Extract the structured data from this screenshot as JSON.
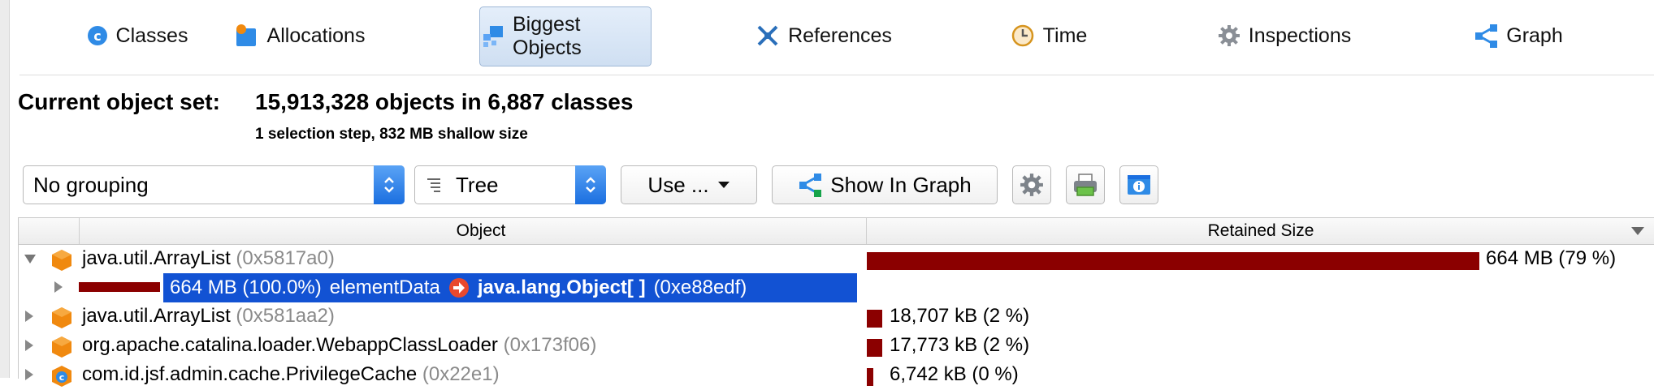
{
  "tabs": [
    {
      "label": "Classes",
      "icon": "classes-icon"
    },
    {
      "label": "Allocations",
      "icon": "allocations-icon"
    },
    {
      "label": "Biggest Objects",
      "icon": "biggest-objects-icon",
      "active": true
    },
    {
      "label": "References",
      "icon": "references-icon"
    },
    {
      "label": "Time",
      "icon": "time-icon"
    },
    {
      "label": "Inspections",
      "icon": "inspections-icon"
    },
    {
      "label": "Graph",
      "icon": "graph-icon"
    }
  ],
  "header": {
    "label": "Current object set:",
    "value": "15,913,328 objects in 6,887 classes",
    "sub": "1 selection step, 832 MB shallow size"
  },
  "toolbar": {
    "grouping": "No grouping",
    "view": "Tree",
    "use_label": "Use ...",
    "show_in_graph": "Show In Graph",
    "icon_buttons": [
      "settings-icon",
      "export-icon",
      "info-icon"
    ]
  },
  "table": {
    "columns": {
      "object": "Object",
      "retained": "Retained Size"
    },
    "rows": [
      {
        "expanded": true,
        "cls": "java.util.ArrayList",
        "addr": "(0x5817a0)",
        "size": "664 MB (79 %)",
        "fraction": 0.79
      },
      {
        "selected": true,
        "size": "664 MB (100.0%)",
        "field": "elementData",
        "target": "java.lang.Object[ ]",
        "target_addr": "(0xe88edf)",
        "fraction": 1.0
      },
      {
        "cls": "java.util.ArrayList",
        "addr": "(0x581aa2)",
        "size": "18,707 kB (2 %)",
        "fraction": 0.02
      },
      {
        "cls": "org.apache.catalina.loader.WebappClassLoader",
        "addr": "(0x173f06)",
        "size": "17,773 kB (2 %)",
        "fraction": 0.02
      },
      {
        "cls": "com.id.jsf.admin.cache.PrivilegeCache",
        "addr": "(0x22e1)",
        "size": "6,742 kB (0 %)",
        "fraction": 0.008
      }
    ]
  },
  "colors": {
    "bar": "#8b0000",
    "selection": "#1252d3",
    "accent": "#1b6fe0",
    "object_icon": "#f0890f"
  }
}
